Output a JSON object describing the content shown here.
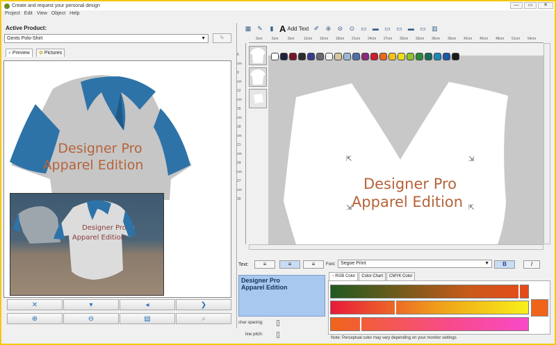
{
  "window": {
    "title": "Create and request your personal design",
    "controls": [
      "—",
      "▭",
      "✕"
    ]
  },
  "menu": [
    "Project",
    "Edit",
    "View",
    "Object",
    "Help"
  ],
  "left": {
    "active_product_label": "Active Product:",
    "product_value": "Gents Polo-Shirt",
    "tabs": [
      "Preview",
      "Pictures"
    ],
    "shirt_text_line1": "Designer Pro",
    "shirt_text_line2": "Apparel Edition",
    "inset_text_line1": "Designer Pro",
    "inset_text_line2": "Apparel Edition"
  },
  "toolbar": {
    "add_text_label": "Add Text"
  },
  "canvas": {
    "text_line1": "Designer Pro",
    "text_line2": "Apparel Edition",
    "ruler_labels": [
      "3cm",
      "5cm",
      "9cm",
      "12cm",
      "15cm",
      "18cm",
      "21cm",
      "24cm",
      "27cm",
      "30cm",
      "33cm",
      "36cm",
      "39cm",
      "42cm",
      "45cm",
      "48cm",
      "51cm",
      "54cm"
    ],
    "left_ruler_labels": [
      "6",
      "cm",
      "9",
      "cm",
      "12",
      "cm",
      "15",
      "cm",
      "18",
      "cm",
      "21",
      "cm",
      "24",
      "cm",
      "27",
      "cm",
      "30"
    ]
  },
  "swatch_colors": [
    "#ffffff",
    "#1f2340",
    "#7a1426",
    "#2c2c2c",
    "#3a3a8a",
    "#6a6a6a",
    "#f2f2f2",
    "#d9c7a0",
    "#9ab8d8",
    "#4f6fa8",
    "#8a2a7a",
    "#d01d2a",
    "#e86a1a",
    "#f3c21a",
    "#e8e01a",
    "#8ac52a",
    "#2a8a3a",
    "#1a6a5a",
    "#1a8ab8",
    "#1a5aa8",
    "#1a1a1a"
  ],
  "text_panel": {
    "text_label": "Text:",
    "font_label": "Font:",
    "font_value": "Segoe Print",
    "bold_label": "B",
    "italic_label": "I",
    "text_content": "Designer Pro\nApparel Edition",
    "char_spacing_label": "char spacing:",
    "line_pitch_label": "line pitch:"
  },
  "color_tabs": [
    "RGB Color",
    "Color Chart",
    "CMYK Color"
  ],
  "note": "Note: Perceptual color may vary depending on your monitor settings"
}
